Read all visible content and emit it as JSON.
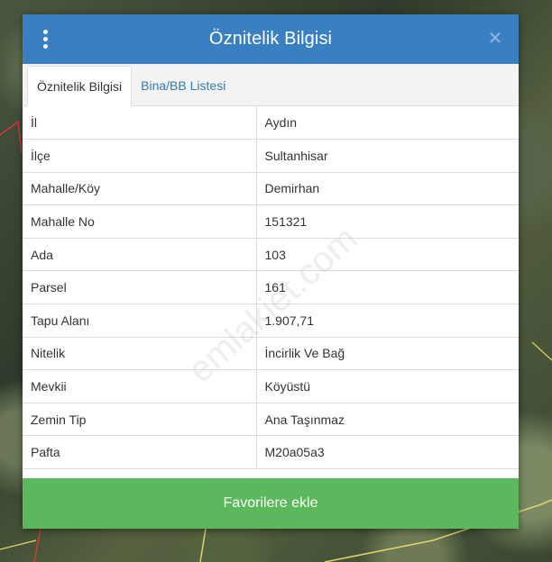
{
  "dialog": {
    "title": "Öznitelik Bilgisi",
    "close_symbol": "✕",
    "tabs": [
      {
        "label": "Öznitelik Bilgisi",
        "active": true
      },
      {
        "label": "Bina/BB Listesi",
        "active": false
      }
    ],
    "rows": [
      {
        "key": "İl",
        "value": "Aydın"
      },
      {
        "key": "İlçe",
        "value": "Sultanhisar"
      },
      {
        "key": "Mahalle/Köy",
        "value": "Demirhan"
      },
      {
        "key": "Mahalle No",
        "value": "151321"
      },
      {
        "key": "Ada",
        "value": "103"
      },
      {
        "key": "Parsel",
        "value": "161"
      },
      {
        "key": "Tapu Alanı",
        "value": "1.907,71"
      },
      {
        "key": "Nitelik",
        "value": "İncirlik Ve Bağ"
      },
      {
        "key": "Mevkii",
        "value": "Köyüstü"
      },
      {
        "key": "Zemin Tip",
        "value": "Ana Taşınmaz"
      },
      {
        "key": "Pafta",
        "value": "M20a05a3"
      }
    ],
    "favorite_button": "Favorilere ekle"
  },
  "watermark": "emlakjet.com",
  "colors": {
    "header": "#3a7fc2",
    "tab_link": "#337ab7",
    "favorite_button": "#5cb85c",
    "map_parcel_line": "#e0d56a",
    "map_boundary_line": "#d23a3a"
  },
  "icons": {
    "menu": "vertical-dots-icon",
    "close": "close-icon"
  }
}
